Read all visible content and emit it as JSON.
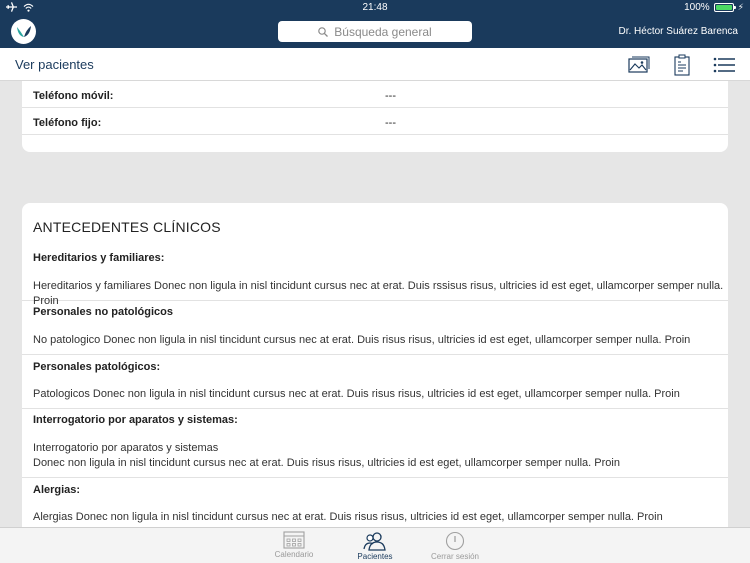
{
  "status": {
    "time": "21:48",
    "battery": "100%"
  },
  "header": {
    "search_placeholder": "Búsqueda general",
    "user_name": "Dr. Héctor Suárez Barenca"
  },
  "nav": {
    "title": "Ver pacientes",
    "icons": [
      "image-icon",
      "clipboard-icon",
      "list-icon"
    ]
  },
  "contact": {
    "rows": [
      {
        "label": "Teléfono móvil:",
        "value": "---"
      },
      {
        "label": "Teléfono fijo:",
        "value": "---"
      }
    ]
  },
  "clinical": {
    "heading": "ANTECEDENTES CLÍNICOS",
    "sections": [
      {
        "title": "Hereditarios y familiares:",
        "text": "Hereditarios y familiares Donec non ligula in nisl tincidunt cursus nec at erat. Duis rssisus risus, ultricies id est eget, ullamcorper semper nulla. Proin"
      },
      {
        "title": "Personales no patológicos",
        "text": "No patologico Donec non ligula in nisl tincidunt cursus nec at erat. Duis risus risus, ultricies id est eget, ullamcorper semper nulla. Proin"
      },
      {
        "title": "Personales patológicos:",
        "text": "Patologicos Donec non ligula in nisl tincidunt cursus nec at erat. Duis risus risus, ultricies id est eget, ullamcorper semper nulla. Proin"
      },
      {
        "title": "Interrogatorio por aparatos y sistemas:",
        "text": "Interrogatorio por aparatos y sistemas",
        "text2": "Donec non ligula in nisl tincidunt cursus nec at erat. Duis risus risus, ultricies id est eget, ullamcorper semper nulla. Proin"
      },
      {
        "title": "Alergias:",
        "text": "Alergias Donec non ligula in nisl tincidunt cursus nec at erat. Duis risus risus, ultricies id est eget, ullamcorper semper nulla. Proin"
      }
    ]
  },
  "tabs": [
    {
      "label": "Calendario",
      "icon": "calendar-icon",
      "active": false
    },
    {
      "label": "Pacientes",
      "icon": "patients-icon",
      "active": true
    },
    {
      "label": "Cerrar sesión",
      "icon": "power-icon",
      "active": false
    }
  ],
  "colors": {
    "primary": "#1a3a5c",
    "accent": "#2aa6a0",
    "battery": "#4cd964"
  }
}
